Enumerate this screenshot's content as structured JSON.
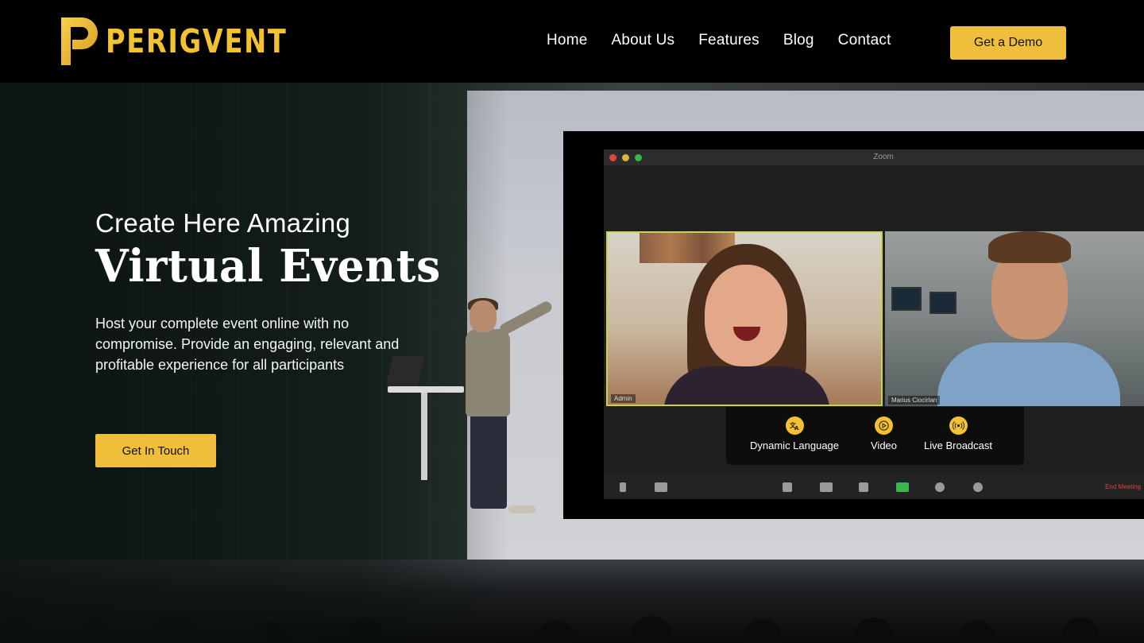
{
  "brand": {
    "name": "PERIGVENT",
    "accent": "#efbe3a",
    "logo_icon": "p-logo-icon"
  },
  "nav": {
    "items": [
      {
        "label": "Home"
      },
      {
        "label": "About Us"
      },
      {
        "label": "Features"
      },
      {
        "label": "Blog"
      },
      {
        "label": "Contact"
      }
    ],
    "cta_label": "Get a Demo"
  },
  "hero": {
    "pre_title": "Create Here Amazing",
    "title": "Virtual Events",
    "lead": "Host your complete event online with no compromise. Provide an engaging, relevant and profitable experience for all participants",
    "cta_label": "Get In Touch"
  },
  "screen": {
    "app_title": "Zoom",
    "participants": [
      {
        "name": "Admin"
      },
      {
        "name": "Marius Ciocirlan"
      }
    ],
    "features": [
      {
        "label": "Dynamic Language",
        "icon": "translate-icon"
      },
      {
        "label": "Video",
        "icon": "play-icon"
      },
      {
        "label": "Live Broadcast",
        "icon": "broadcast-icon"
      }
    ],
    "end_label": "End Meeting"
  }
}
